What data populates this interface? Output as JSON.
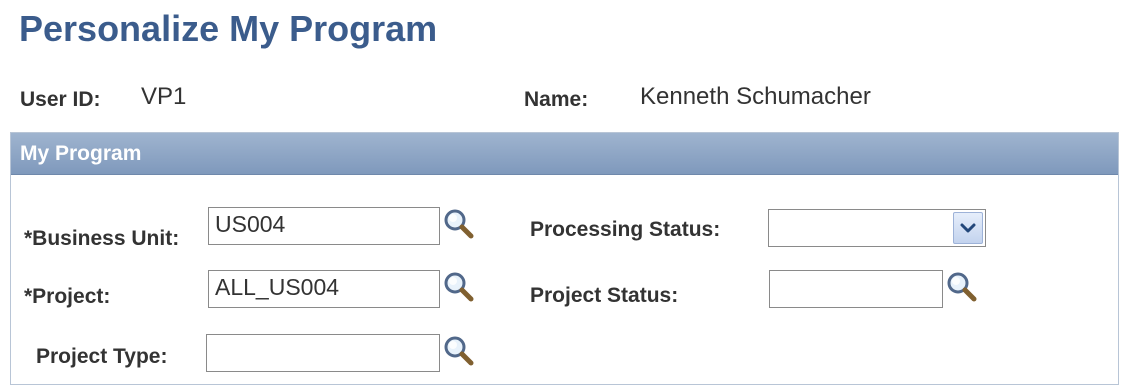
{
  "header": {
    "title": "Personalize My Program"
  },
  "user": {
    "user_id_label": "User ID:",
    "user_id_value": "VP1",
    "name_label": "Name:",
    "name_value": "Kenneth Schumacher"
  },
  "group": {
    "title": "My Program"
  },
  "fields": {
    "business_unit": {
      "label": "*Business Unit:",
      "value": "US004"
    },
    "project": {
      "label": "*Project:",
      "value": "ALL_US004"
    },
    "project_type": {
      "label": "Project Type:",
      "value": ""
    },
    "processing_status": {
      "label": "Processing Status:",
      "value": ""
    },
    "project_status": {
      "label": "Project Status:",
      "value": ""
    }
  },
  "icons": {
    "lookup": "magnifier-icon",
    "dropdown": "chevron-down-icon"
  },
  "colors": {
    "title": "#3b5c8c",
    "group_header": "#8aa3c4",
    "label": "#333333"
  }
}
